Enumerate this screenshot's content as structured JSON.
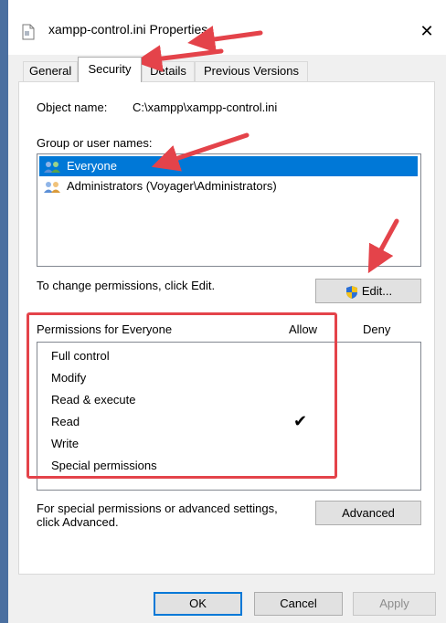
{
  "window": {
    "title": "xampp-control.ini Properties",
    "close_glyph": "✕"
  },
  "tabs": [
    {
      "label": "General"
    },
    {
      "label": "Security",
      "active": true
    },
    {
      "label": "Details"
    },
    {
      "label": "Previous Versions"
    }
  ],
  "security": {
    "object_name_label": "Object name:",
    "object_name_value": "C:\\xampp\\xampp-control.ini",
    "group_label": "Group or user names:",
    "users": [
      {
        "name": "Everyone",
        "selected": true,
        "icon": "users-icon"
      },
      {
        "name": "Administrators (Voyager\\Administrators)",
        "selected": false,
        "icon": "users-icon"
      }
    ],
    "change_hint": "To change permissions, click Edit.",
    "edit_button": "Edit...",
    "edit_icon": "uac-shield-icon",
    "permissions_header": "Permissions for Everyone",
    "allow_header": "Allow",
    "deny_header": "Deny",
    "permissions": [
      {
        "name": "Full control",
        "allow": false,
        "deny": false
      },
      {
        "name": "Modify",
        "allow": false,
        "deny": false
      },
      {
        "name": "Read & execute",
        "allow": false,
        "deny": false
      },
      {
        "name": "Read",
        "allow": true,
        "deny": false
      },
      {
        "name": "Write",
        "allow": false,
        "deny": false
      },
      {
        "name": "Special permissions",
        "allow": false,
        "deny": false
      }
    ],
    "check_glyph": "✔",
    "advanced_hint_line1": "For special permissions or advanced settings,",
    "advanced_hint_line2": "click Advanced.",
    "advanced_button": "Advanced"
  },
  "footer": {
    "ok": "OK",
    "cancel": "Cancel",
    "apply": "Apply"
  },
  "colors": {
    "annotation_red": "#e4434a",
    "selection_blue": "#0078d7"
  }
}
